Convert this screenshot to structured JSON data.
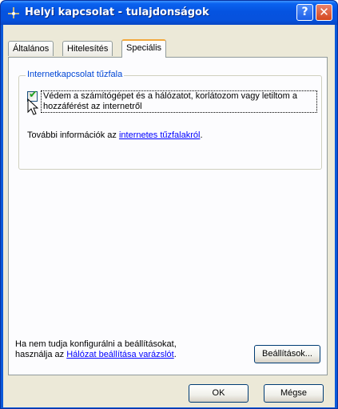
{
  "window": {
    "title": "Helyi kapcsolat - tulajdonságok",
    "help_glyph": "?",
    "close_glyph": "✕"
  },
  "tabs": [
    {
      "label": "Általános",
      "active": false
    },
    {
      "label": "Hitelesítés",
      "active": false
    },
    {
      "label": "Speciális",
      "active": true
    }
  ],
  "firewall_group": {
    "legend": "Internetkapcsolat tűzfala",
    "checkbox_label": "Védem a számítógépet és a hálózatot, korlátozom vagy letiltom a hozzáférést az internetről",
    "checkbox_checked": true,
    "checkmark_glyph": "✔",
    "info_prefix": "További információk az ",
    "info_link": "internetes tűzfalakról",
    "info_suffix": "."
  },
  "wizard_hint": {
    "line1": "Ha nem tudja konfigurálni a beállításokat,",
    "line2_prefix": "használja az ",
    "line2_link": "Hálózat beállítása varázslót",
    "line2_suffix": "."
  },
  "buttons": {
    "settings": "Beállítások...",
    "ok": "OK",
    "cancel": "Mégse"
  },
  "colors": {
    "titlebar": "#0553e0",
    "dialog_bg": "#ece9d8",
    "link": "#0000ff",
    "group_legend": "#0046d5"
  }
}
